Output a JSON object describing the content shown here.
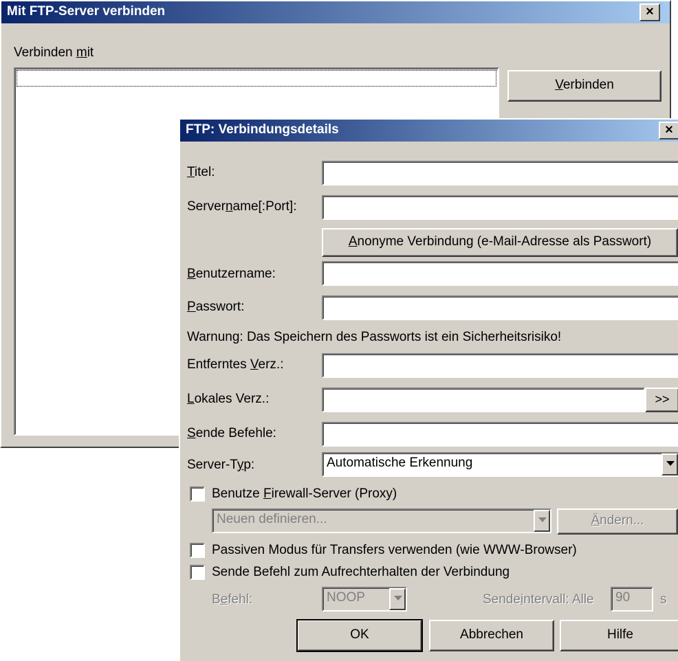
{
  "back_window": {
    "title": "Mit FTP-Server verbinden",
    "close_glyph": "×",
    "connect_with_label_pre": "Verbinden ",
    "connect_with_label_ul": "m",
    "connect_with_label_post": "it",
    "connect_button_ul": "V",
    "connect_button_rest": "erbinden"
  },
  "dialog": {
    "title": "FTP: Verbindungsdetails",
    "close_glyph": "×",
    "title_label": {
      "ul": "T",
      "rest": "itel:"
    },
    "server_label": {
      "pre": "Server",
      "ul": "n",
      "rest": "ame[:Port]:"
    },
    "anon_button": {
      "ul": "A",
      "rest": "nonyme Verbindung (e-Mail-Adresse als Passwort)"
    },
    "user_label": {
      "ul": "B",
      "rest": "enutzername:"
    },
    "password_label": {
      "ul": "P",
      "rest": "asswort:"
    },
    "warning": "Warnung: Das Speichern des Passworts ist ein Sicherheitsrisiko!",
    "remote_dir_label": {
      "pre": "Entferntes ",
      "ul": "V",
      "rest": "erz.:"
    },
    "local_dir_label": {
      "ul": "L",
      "rest": "okales Verz.:"
    },
    "browse_button": ">>",
    "send_commands_label": {
      "ul": "S",
      "rest": "ende Befehle:"
    },
    "server_type_label": {
      "pre": "Server-T",
      "ul": "y",
      "rest": "p:"
    },
    "server_type_value": "Automatische Erkennung",
    "firewall_checkbox": {
      "pre": "Benutze ",
      "ul": "F",
      "rest": "irewall-Server (Proxy)"
    },
    "firewall_select_value": "Neuen definieren...",
    "change_button": {
      "ul": "Ä",
      "rest": "ndern..."
    },
    "passive_checkbox": "Passiven Modus für Transfers verwenden (wie WWW-Browser)",
    "keepalive_checkbox": "Sende Befehl zum Aufrechterhalten der Verbindung",
    "command_label": {
      "pre": "B",
      "ul": "e",
      "rest": "fehl:"
    },
    "command_value": "NOOP",
    "interval_label": {
      "pre": "Sende",
      "ul": "i",
      "rest": "ntervall: Alle"
    },
    "interval_value": "90",
    "interval_unit": "s",
    "ok_button": "OK",
    "cancel_button": "Abbrechen",
    "help_button": "Hilfe"
  }
}
